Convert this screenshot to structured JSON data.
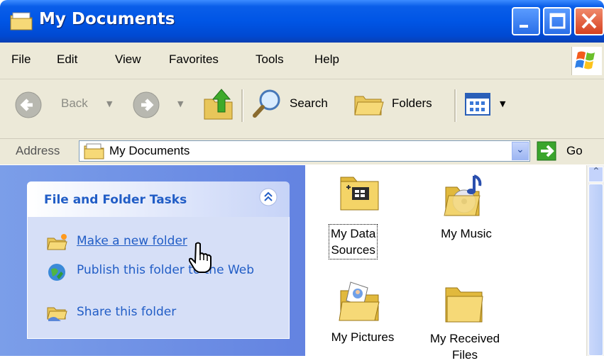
{
  "window": {
    "title": "My Documents",
    "icons": {
      "title": "my-documents-folder-icon",
      "min": "minimize-icon",
      "max": "maximize-icon",
      "close": "close-icon"
    }
  },
  "menu": [
    "File",
    "Edit",
    "View",
    "Favorites",
    "Tools",
    "Help"
  ],
  "toolbar": {
    "back_label": "Back",
    "search_label": "Search",
    "folders_label": "Folders"
  },
  "address": {
    "label": "Address",
    "value": "My Documents",
    "go_label": "Go"
  },
  "tasks": {
    "title": "File and Folder Tasks",
    "items": [
      {
        "label": "Make a new folder",
        "icon": "new-folder-icon"
      },
      {
        "label": "Publish this folder to the Web",
        "icon": "publish-web-icon"
      },
      {
        "label": "Share this folder",
        "icon": "share-folder-icon"
      }
    ]
  },
  "files": [
    {
      "label_line1": "My Data",
      "label_line2": "Sources",
      "icon": "data-sources-folder-icon"
    },
    {
      "label_line1": "My Music",
      "label_line2": "",
      "icon": "music-folder-icon"
    },
    {
      "label_line1": "My Pictures",
      "label_line2": "",
      "icon": "pictures-folder-icon"
    },
    {
      "label_line1": "My Received",
      "label_line2": "Files",
      "icon": "received-files-folder-icon"
    }
  ],
  "colors": {
    "titlebar": "#0055e5",
    "chrome": "#ece9d8",
    "task_link": "#215dc6",
    "left_pane": "#6f92e6"
  }
}
